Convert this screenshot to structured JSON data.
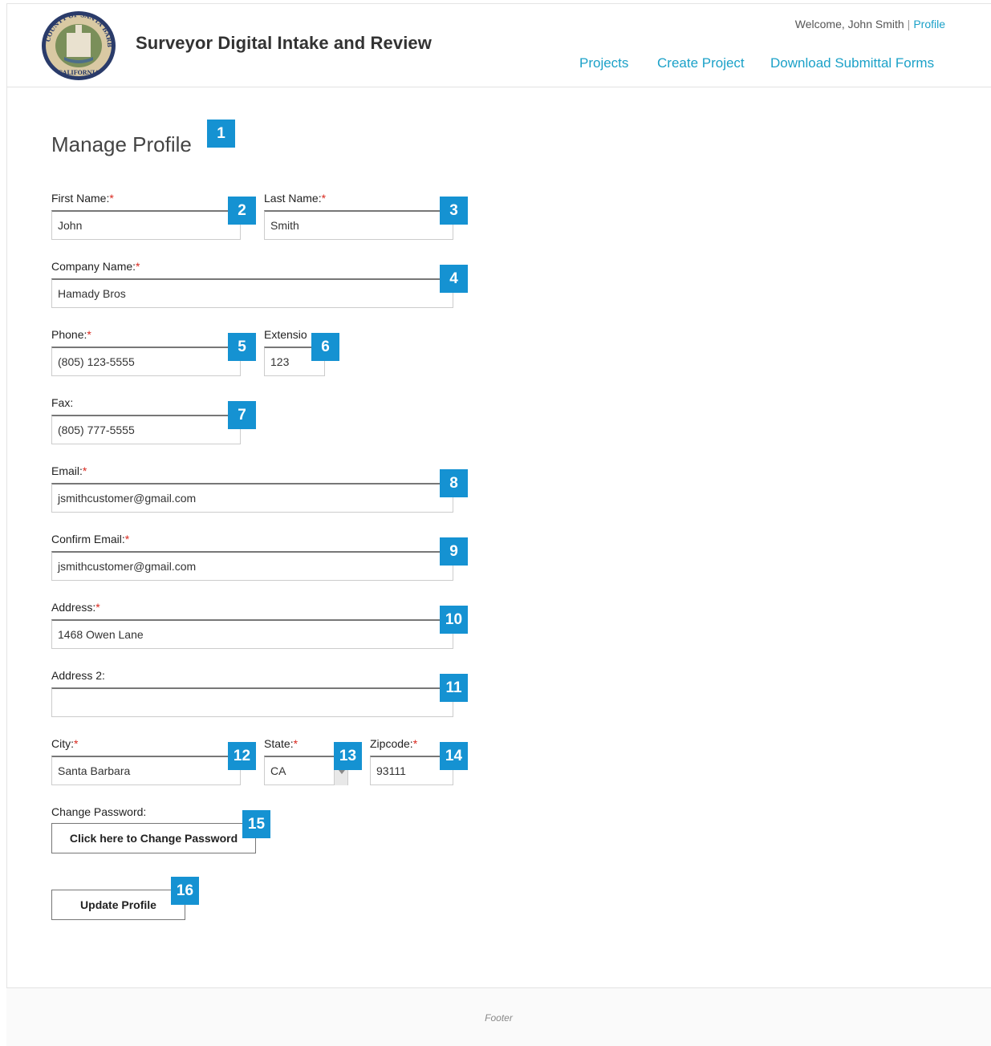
{
  "header": {
    "title": "Surveyor Digital Intake and Review",
    "welcome": "Welcome, John Smith",
    "separator": "|",
    "profile_link": "Profile",
    "nav": [
      "Projects",
      "Create Project",
      "Download Submittal Forms"
    ],
    "seal_text": "COUNTY OF SANTA BARBARA CALIFORNIA"
  },
  "page": {
    "title": "Manage Profile"
  },
  "fields": {
    "first_name": {
      "label": "First Name:",
      "value": "John"
    },
    "last_name": {
      "label": "Last Name:",
      "value": "Smith"
    },
    "company": {
      "label": "Company Name:",
      "value": "Hamady Bros"
    },
    "phone": {
      "label": "Phone:",
      "value": "(805) 123-5555"
    },
    "extension": {
      "label": "Extensio",
      "value": "123"
    },
    "fax": {
      "label": "Fax:",
      "value": "(805) 777-5555"
    },
    "email": {
      "label": "Email:",
      "value": "jsmithcustomer@gmail.com"
    },
    "confirm_email": {
      "label": "Confirm Email:",
      "value": "jsmithcustomer@gmail.com"
    },
    "address": {
      "label": "Address:",
      "value": "1468 Owen Lane"
    },
    "address2": {
      "label": "Address 2:",
      "value": ""
    },
    "city": {
      "label": "City:",
      "value": "Santa Barbara"
    },
    "state": {
      "label": "State:",
      "value": "CA"
    },
    "zipcode": {
      "label": "Zipcode:",
      "value": "93111"
    }
  },
  "required_marker": "*",
  "change_password": {
    "label": "Change Password:",
    "button": "Click here to Change Password"
  },
  "update_button": "Update Profile",
  "badges": [
    "1",
    "2",
    "3",
    "4",
    "5",
    "6",
    "7",
    "8",
    "9",
    "10",
    "11",
    "12",
    "13",
    "14",
    "15",
    "16"
  ],
  "footer": "Footer",
  "colors": {
    "link": "#1ba1c8",
    "badge": "#1592d2",
    "required": "#d9281e"
  }
}
